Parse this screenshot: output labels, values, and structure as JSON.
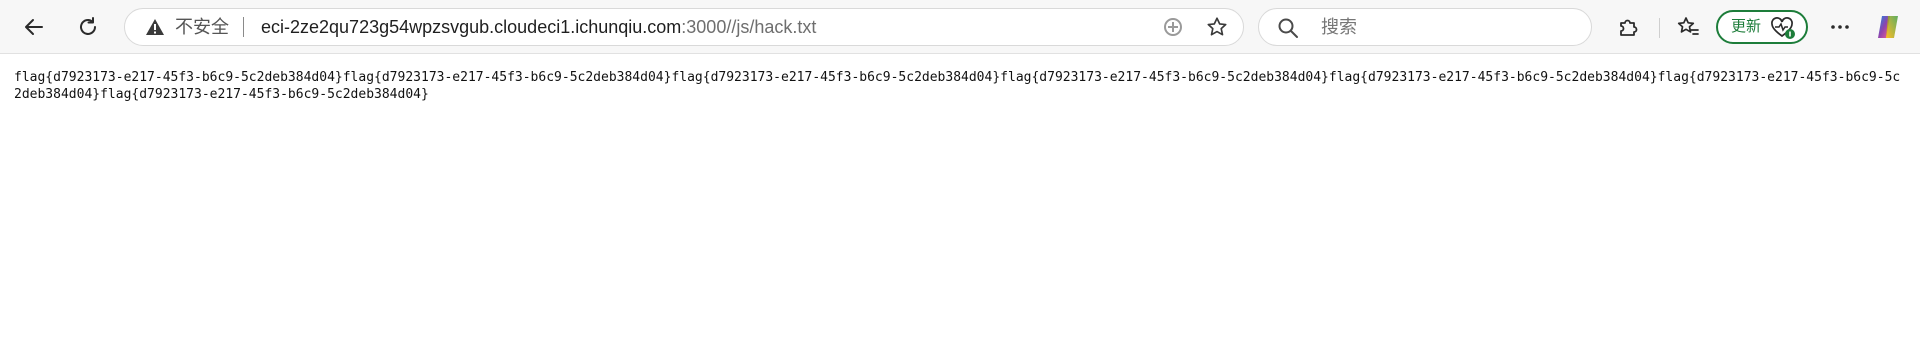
{
  "browser": {
    "nav": {
      "back_icon": "arrow-left-icon",
      "reload_icon": "reload-icon"
    },
    "address_bar": {
      "security_label": "不安全",
      "url_host": "eci-2ze2qu723g54wpzsvgub.cloudeci1.ichunqiu.com",
      "url_rest": ":3000//js/hack.txt"
    },
    "search": {
      "placeholder": "搜索"
    },
    "toolbar": {
      "update_label": "更新"
    },
    "colors": {
      "toolbar_bg": "#f7f7f7",
      "update_green": "#1d7d3a"
    }
  },
  "page": {
    "text": "flag{d7923173-e217-45f3-b6c9-5c2deb384d04}flag{d7923173-e217-45f3-b6c9-5c2deb384d04}flag{d7923173-e217-45f3-b6c9-5c2deb384d04}flag{d7923173-e217-45f3-b6c9-5c2deb384d04}flag{d7923173-e217-45f3-b6c9-5c2deb384d04}flag{d7923173-e217-45f3-b6c9-5c2deb384d04}flag{d7923173-e217-45f3-b6c9-5c2deb384d04}"
  }
}
